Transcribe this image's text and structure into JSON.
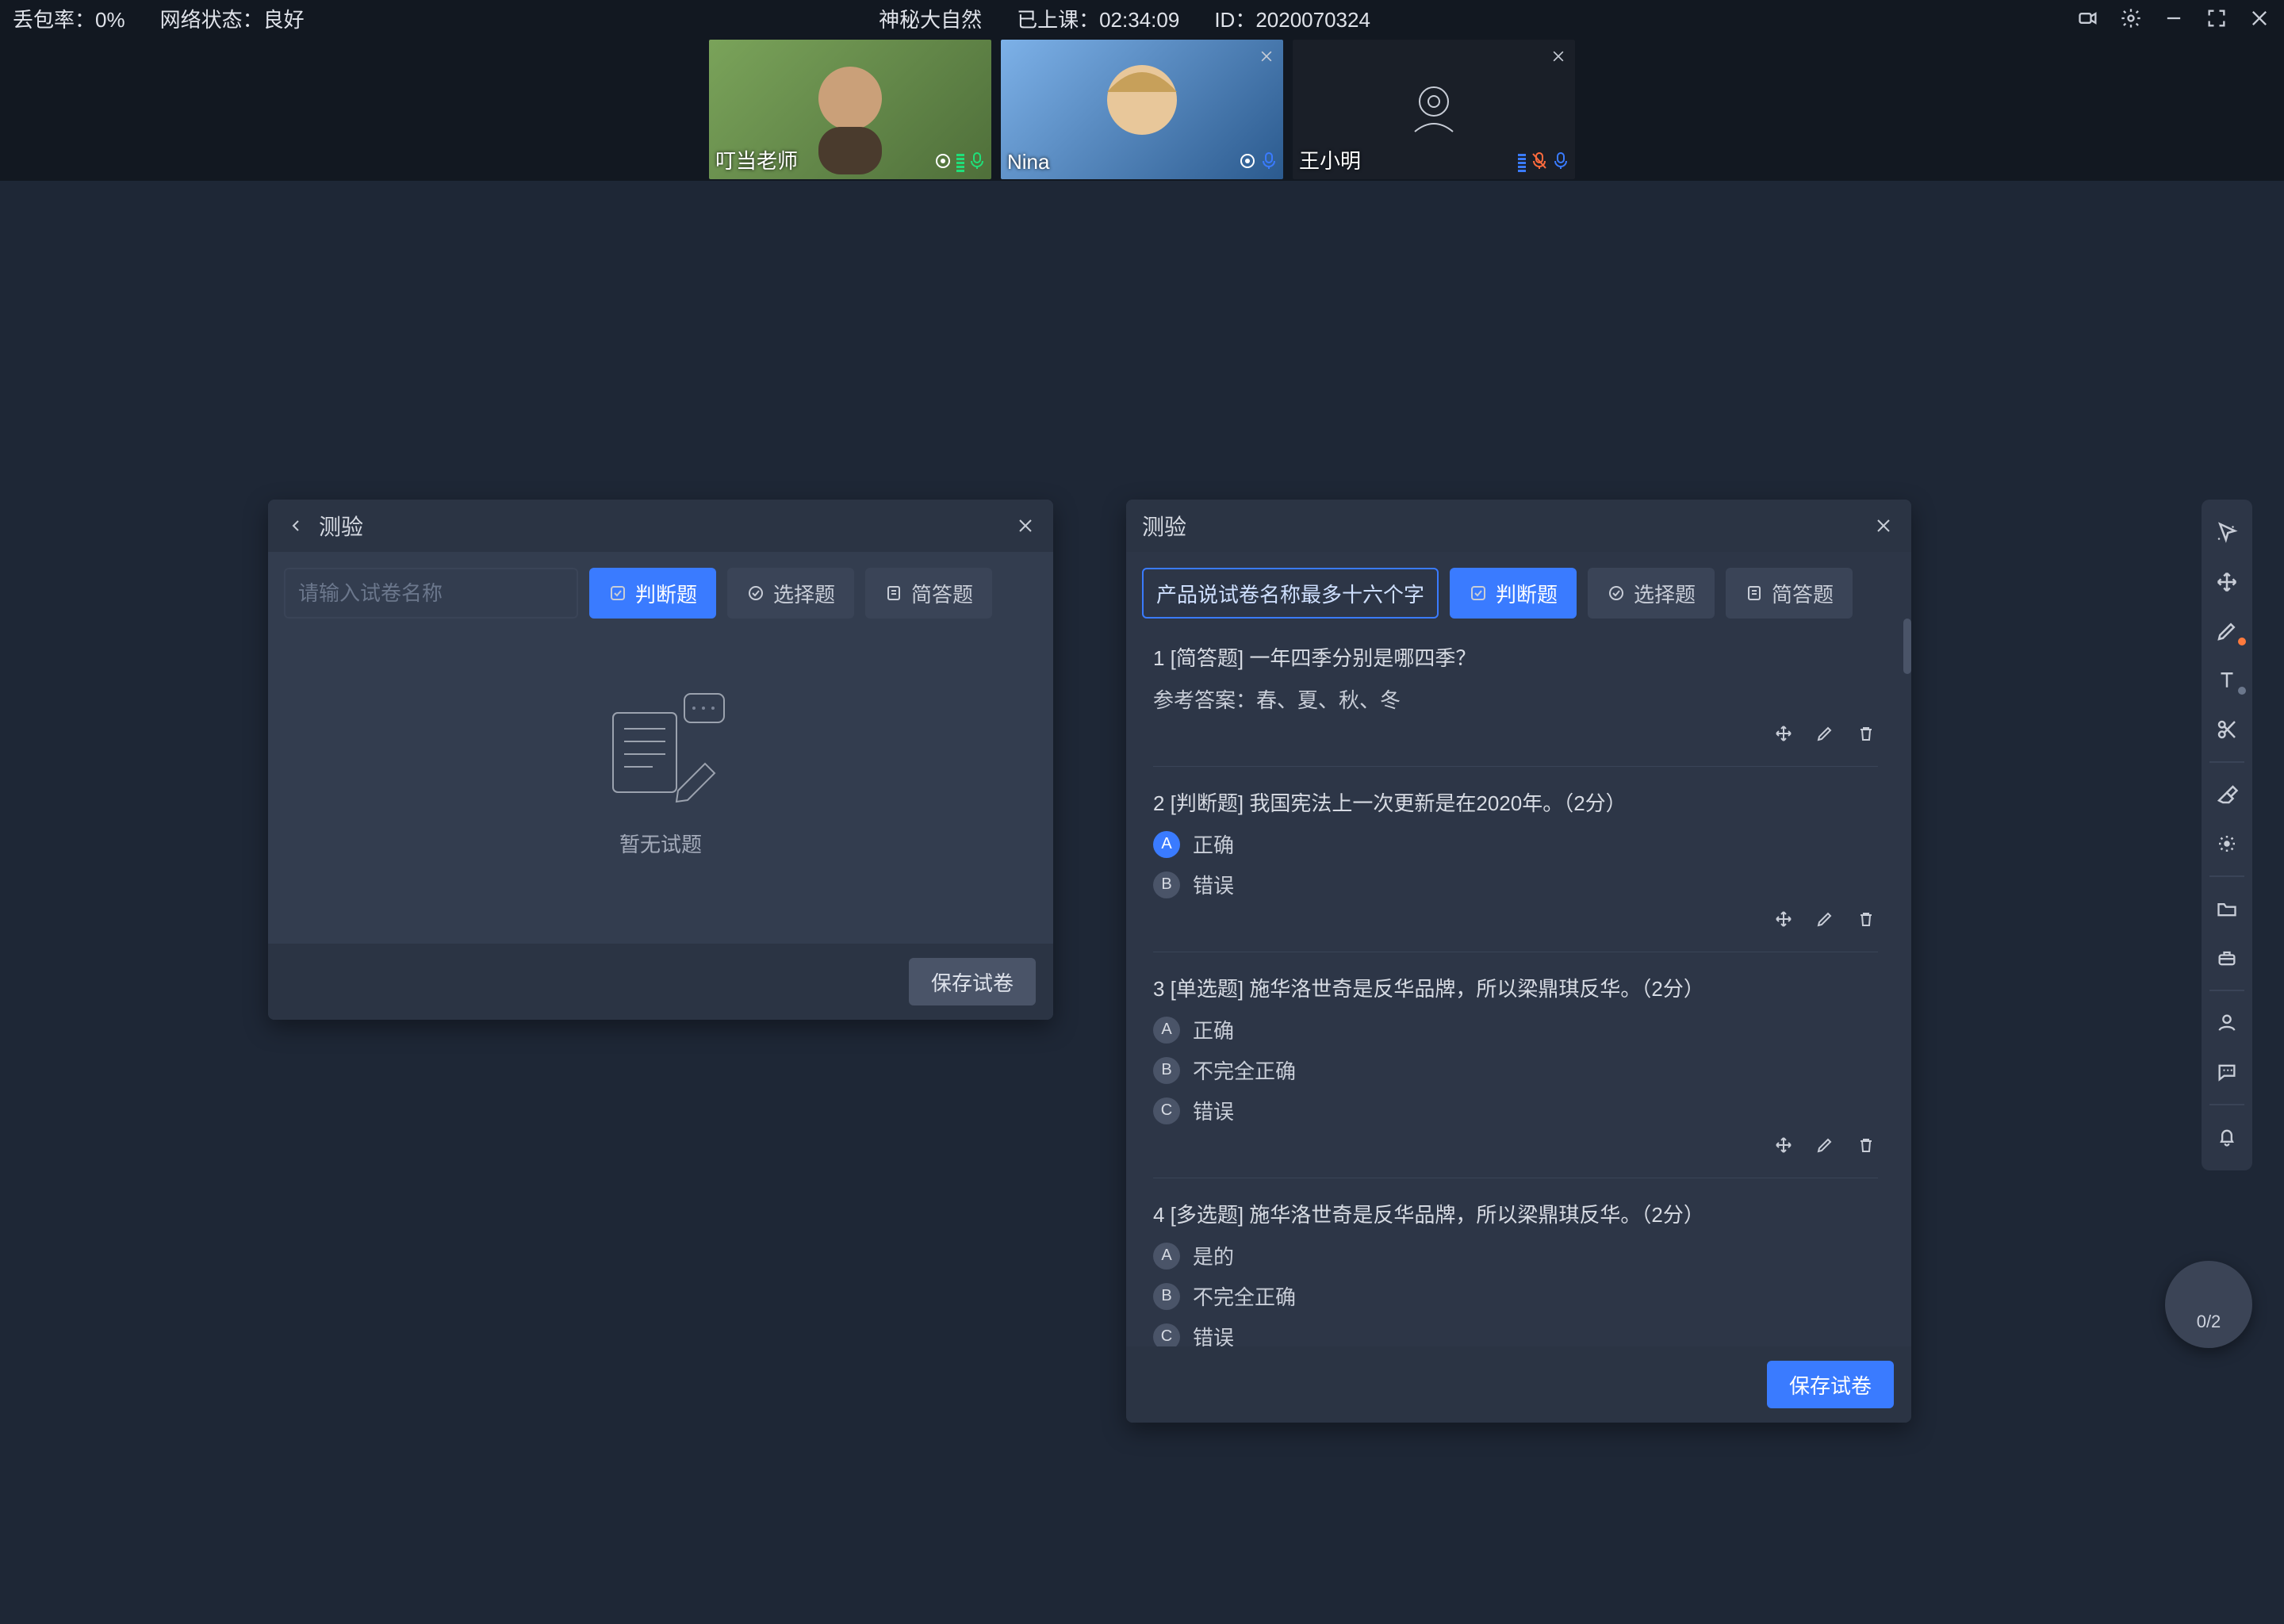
{
  "status": {
    "loss_label": "丢包率：",
    "loss_value": "0%",
    "net_label": "网络状态：",
    "net_value": "良好",
    "title": "神秘大自然",
    "elapsed_label": "已上课：",
    "elapsed_value": "02:34:09",
    "id_label": "ID：",
    "id_value": "2020070324"
  },
  "tiles": [
    {
      "name": "叮当老师"
    },
    {
      "name": "Nina"
    },
    {
      "name": "王小明"
    }
  ],
  "panel_left": {
    "title": "测验",
    "title_placeholder": "请输入试卷名称",
    "btns": {
      "judge": "判断题",
      "choice": "选择题",
      "short": "简答题"
    },
    "empty": "暂无试题",
    "save": "保存试卷"
  },
  "panel_right": {
    "title": "测验",
    "title_value": "产品说试卷名称最多十六个字",
    "btns": {
      "judge": "判断题",
      "choice": "选择题",
      "short": "简答题"
    },
    "answer_label": "参考答案：",
    "save": "保存试卷",
    "questions": [
      {
        "num": "1",
        "tag": "[简答题]",
        "text": "一年四季分别是哪四季？",
        "answer": "春、夏、秋、冬"
      },
      {
        "num": "2",
        "tag": "[判断题]",
        "text": "我国宪法上一次更新是在2020年。（2分）",
        "options": [
          {
            "k": "A",
            "v": "正确",
            "sel": true
          },
          {
            "k": "B",
            "v": "错误"
          }
        ]
      },
      {
        "num": "3",
        "tag": "[单选题]",
        "text": "施华洛世奇是反华品牌，所以梁鼎琪反华。（2分）",
        "options": [
          {
            "k": "A",
            "v": "正确"
          },
          {
            "k": "B",
            "v": "不完全正确"
          },
          {
            "k": "C",
            "v": "错误"
          }
        ]
      },
      {
        "num": "4",
        "tag": "[多选题]",
        "text": "施华洛世奇是反华品牌，所以梁鼎琪反华。（2分）",
        "options": [
          {
            "k": "A",
            "v": "是的"
          },
          {
            "k": "B",
            "v": "不完全正确"
          },
          {
            "k": "C",
            "v": "错误"
          }
        ]
      }
    ]
  },
  "fab": {
    "count": "0/2"
  }
}
